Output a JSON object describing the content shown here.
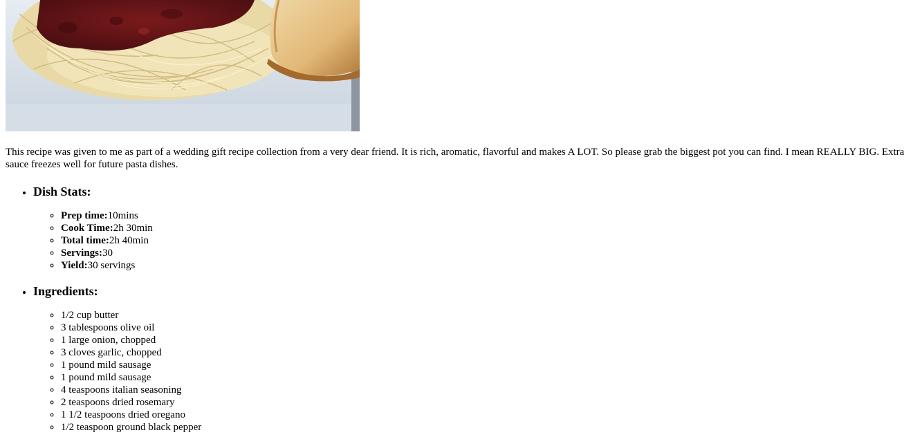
{
  "photo": {
    "alt": "spaghetti with meat sauce and garlic bread"
  },
  "intro": "This recipe was given to me as part of a wedding gift recipe collection from a very dear friend. It is rich, aromatic, flavorful and makes A LOT. So please grab the biggest pot you can find. I mean REALLY BIG. Extra sauce freezes well for future pasta dishes.",
  "stats": {
    "heading": "Dish Stats:",
    "items": [
      {
        "label": "Prep time:",
        "value": "10mins"
      },
      {
        "label": "Cook Time:",
        "value": "2h 30min"
      },
      {
        "label": "Total time:",
        "value": "2h 40min"
      },
      {
        "label": "Servings:",
        "value": "30"
      },
      {
        "label": "Yield:",
        "value": "30 servings"
      }
    ]
  },
  "ingredients": {
    "heading": "Ingredients:",
    "items": [
      "1/2 cup butter",
      "3 tablespoons olive oil",
      "1 large onion, chopped",
      "3 cloves garlic, chopped",
      "1 pound mild sausage",
      "1 pound mild sausage",
      "4 teaspoons italian seasoning",
      "2 teaspoons dried rosemary",
      "1 1/2 teaspoons dried oregano",
      "1/2 teaspoon ground black pepper"
    ]
  }
}
